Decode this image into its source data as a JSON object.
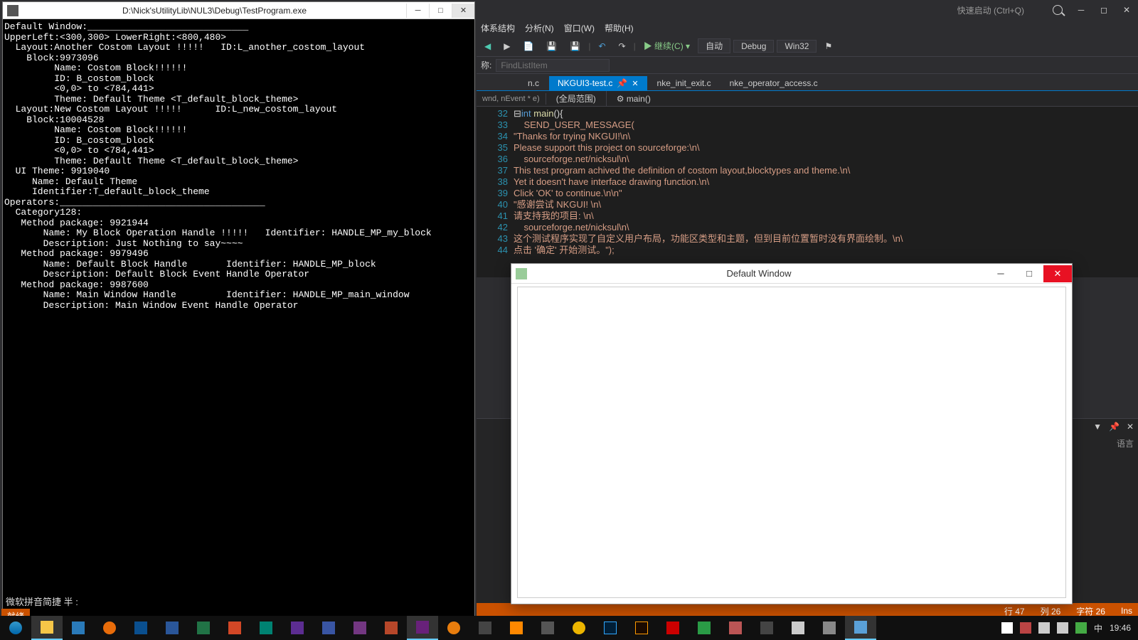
{
  "console": {
    "title": "D:\\Nick'sUtilityLib\\NUL3\\Debug\\TestProgram.exe",
    "lines": [
      "Default Window:_____________________________",
      "UpperLeft:<300,300> LowerRight:<800,480>",
      "  Layout:Another Costom Layout !!!!!   ID:L_another_costom_layout",
      "    Block:9973096",
      "         Name: Costom Block!!!!!!",
      "         ID: B_costom_block",
      "         <0,0> to <784,441>",
      "         Theme: Default Theme <T_default_block_theme>",
      "  Layout:New Costom Layout !!!!!      ID:L_new_costom_layout",
      "    Block:10004528",
      "         Name: Costom Block!!!!!!",
      "         ID: B_costom_block",
      "         <0,0> to <784,441>",
      "         Theme: Default Theme <T_default_block_theme>",
      "  UI Theme: 9919040",
      "     Name: Default Theme",
      "     Identifier:T_default_block_theme",
      "Operators:_____________________________________",
      "  Category128:",
      "   Method package: 9921944",
      "       Name: My Block Operation Handle !!!!!   Identifier: HANDLE_MP_my_block",
      "       Description: Just Nothing to say~~~~",
      "   Method package: 9979496",
      "       Name: Default Block Handle       Identifier: HANDLE_MP_block",
      "       Description: Default Block Event Handle Operator",
      "   Method package: 9987600",
      "       Name: Main Window Handle         Identifier: HANDLE_MP_main_window",
      "       Description: Main Window Event Handle Operator"
    ]
  },
  "vs": {
    "quick_launch": "快速启动 (Ctrl+Q)",
    "menu": [
      "体系结构",
      "分析(N)",
      "窗口(W)",
      "帮助(H)"
    ],
    "toolbar": {
      "continue": "继续(C)",
      "auto": "自动",
      "debug": "Debug",
      "platform": "Win32"
    },
    "find_placeholder": "FindListItem",
    "find_label": "称:",
    "tabs": [
      {
        "label": "n.c",
        "active": false
      },
      {
        "label": "NKGUI3-test.c",
        "active": true
      },
      {
        "label": "nke_init_exit.c",
        "active": false
      },
      {
        "label": "nke_operator_access.c",
        "active": false
      }
    ],
    "context_left_small": "wnd, nEvent * e)",
    "scope": "(全局范围)",
    "fn": "main()",
    "code_lines": [
      {
        "n": 32,
        "t": "int main(){",
        "kw": true
      },
      {
        "n": 33,
        "t": "    SEND_USER_MESSAGE("
      },
      {
        "n": 34,
        "t": "\"Thanks for trying NKGUI!\\n\\"
      },
      {
        "n": 35,
        "t": "Please support this project on sourceforge:\\n\\"
      },
      {
        "n": 36,
        "t": "    sourceforge.net/nicksul\\n\\"
      },
      {
        "n": 37,
        "t": "This test program achived the definition of costom layout,blocktypes and theme.\\n\\"
      },
      {
        "n": 38,
        "t": "Yet it doesn't have interface drawing function.\\n\\"
      },
      {
        "n": 39,
        "t": "Click 'OK' to continue.\\n\\n\""
      },
      {
        "n": 40,
        "t": "\"感谢尝试 NKGUI! \\n\\"
      },
      {
        "n": 41,
        "t": "请支持我的项目: \\n\\"
      },
      {
        "n": 42,
        "t": "    sourceforge.net/nicksul\\n\\"
      },
      {
        "n": 43,
        "t": "这个测试程序实现了自定义用户布局，功能区类型和主题，但到目前位置暂时没有界面绘制。\\n\\"
      },
      {
        "n": 44,
        "t": "点击 '确定' 开始测试。\");"
      }
    ],
    "panel_lang": "语言",
    "status": {
      "ready": "就绪",
      "line": "行 47",
      "col": "列 26",
      "char": "字符 26",
      "ins": "Ins"
    }
  },
  "popup": {
    "title": "Default Window"
  },
  "ime": "微软拼音简捷 半 :",
  "tray": {
    "lang": "中",
    "time": "19:46"
  },
  "taskbar_icons": [
    "ie",
    "explorer",
    "desktop",
    "media",
    "onedrive",
    "word",
    "excel",
    "powerpoint",
    "publisher",
    "onenote",
    "lync",
    "infopath",
    "access",
    "visualstudio",
    "blender",
    "compass",
    "vlc",
    "gamepad",
    "chrome-canary",
    "photoshop",
    "bridge",
    "pdf",
    "utorrent",
    "foobar",
    "7zip",
    "calc",
    "grid",
    "monitor"
  ]
}
